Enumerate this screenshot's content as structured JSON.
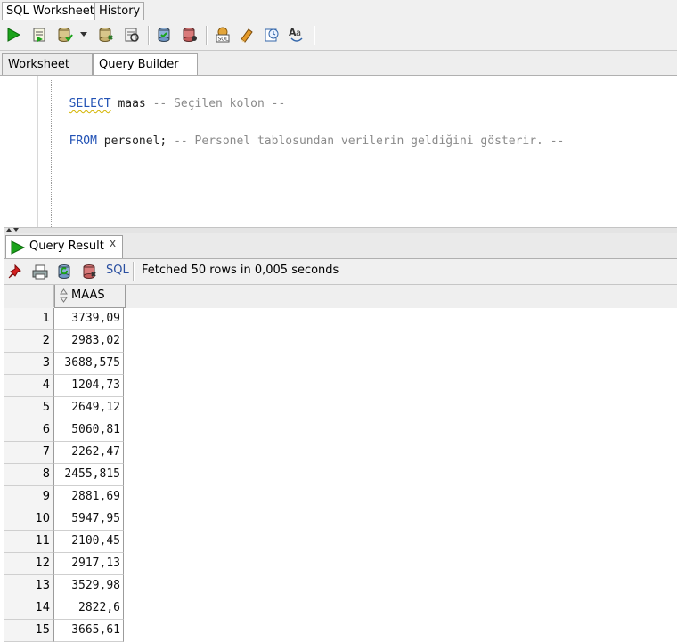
{
  "top_tabs": {
    "worksheet": "SQL Worksheet",
    "history": "History"
  },
  "editor_tabs": {
    "worksheet": "Worksheet",
    "query_builder": "Query Builder"
  },
  "editor": {
    "line1": {
      "keyword": "SELECT",
      "ident": " maas ",
      "comment": "-- Seçilen kolon --"
    },
    "line2": {
      "keyword": "FROM",
      "ident": " personel; ",
      "comment": "-- Personel tablosundan verilerin geldiğini gösterir. --"
    }
  },
  "result": {
    "tab_label": "Query Result",
    "tab_close": "x",
    "sql_label": "SQL",
    "status": "Fetched 50 rows in 0,005 seconds",
    "column": "MAAS",
    "rows": [
      {
        "n": "1",
        "v": "3739,09"
      },
      {
        "n": "2",
        "v": "2983,02"
      },
      {
        "n": "3",
        "v": "3688,575"
      },
      {
        "n": "4",
        "v": "1204,73"
      },
      {
        "n": "5",
        "v": "2649,12"
      },
      {
        "n": "6",
        "v": "5060,81"
      },
      {
        "n": "7",
        "v": "2262,47"
      },
      {
        "n": "8",
        "v": "2455,815"
      },
      {
        "n": "9",
        "v": "2881,69"
      },
      {
        "n": "10",
        "v": "5947,95"
      },
      {
        "n": "11",
        "v": "2100,45"
      },
      {
        "n": "12",
        "v": "2917,13"
      },
      {
        "n": "13",
        "v": "3529,98"
      },
      {
        "n": "14",
        "v": "2822,6"
      },
      {
        "n": "15",
        "v": "3665,61"
      }
    ]
  },
  "icons": {
    "toolbar": [
      "run-statement-icon",
      "run-script-icon",
      "commit-icon",
      "dropdown-arrow-icon",
      "rollback-icon",
      "autotrace-icon",
      "explain-plan-icon",
      "sql-tuning-icon",
      "sql-history-icon",
      "clear-icon",
      "unshared-worksheet-icon",
      "format-case-icon"
    ],
    "result_toolbar": [
      "freeze-pin-icon",
      "print-icon",
      "refresh-icon",
      "export-icon"
    ]
  },
  "colors": {
    "keyword": "#2252b5",
    "comment": "#8a8a8a",
    "run_green": "#1aa31a"
  }
}
